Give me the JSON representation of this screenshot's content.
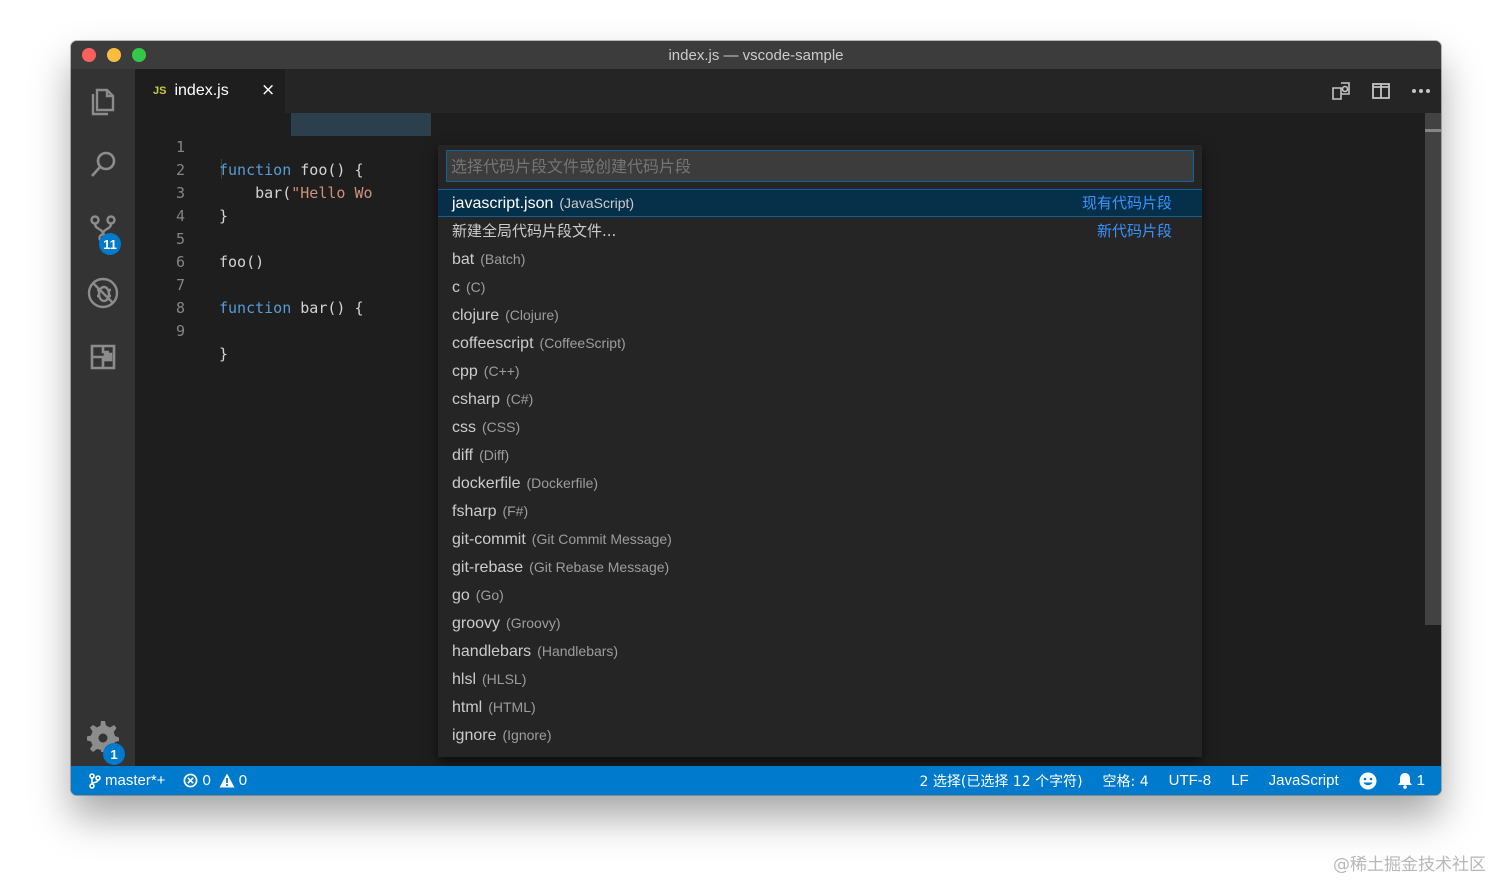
{
  "window": {
    "title": "index.js — vscode-sample"
  },
  "activity_bar": {
    "items": [
      {
        "icon": "explorer-icon"
      },
      {
        "icon": "search-icon"
      },
      {
        "icon": "source-control-icon",
        "badge": "11"
      },
      {
        "icon": "debug-icon"
      },
      {
        "icon": "extensions-icon"
      }
    ],
    "settings": {
      "icon": "gear-icon",
      "badge": "1"
    }
  },
  "tabs": [
    {
      "language_icon": "JS",
      "label": "index.js",
      "close": "×"
    }
  ],
  "editor": {
    "line_numbers": [
      "1",
      "2",
      "3",
      "4",
      "5",
      "6",
      "7",
      "8",
      "9"
    ],
    "lines": [
      {
        "kw": "function",
        "rest": " foo() {"
      },
      {
        "kw": "",
        "rest": "    bar(",
        "str": "\"Hello Wo"
      },
      {
        "kw": "",
        "rest": "}"
      },
      {
        "kw": "",
        "rest": ""
      },
      {
        "kw": "",
        "rest": "foo()"
      },
      {
        "kw": "",
        "rest": ""
      },
      {
        "kw": "function",
        "rest": " bar() {"
      },
      {
        "kw": "",
        "rest": ""
      },
      {
        "kw": "",
        "rest": "}"
      }
    ]
  },
  "quick_pick": {
    "placeholder": "选择代码片段文件或创建代码片段",
    "items": [
      {
        "label": "javascript.json",
        "desc": "(JavaScript)",
        "right": "现有代码片段"
      },
      {
        "label": "新建全局代码片段文件...",
        "desc": "",
        "right": "新代码片段"
      },
      {
        "label": "bat",
        "desc": "(Batch)"
      },
      {
        "label": "c",
        "desc": "(C)"
      },
      {
        "label": "clojure",
        "desc": "(Clojure)"
      },
      {
        "label": "coffeescript",
        "desc": "(CoffeeScript)"
      },
      {
        "label": "cpp",
        "desc": "(C++)"
      },
      {
        "label": "csharp",
        "desc": "(C#)"
      },
      {
        "label": "css",
        "desc": "(CSS)"
      },
      {
        "label": "diff",
        "desc": "(Diff)"
      },
      {
        "label": "dockerfile",
        "desc": "(Dockerfile)"
      },
      {
        "label": "fsharp",
        "desc": "(F#)"
      },
      {
        "label": "git-commit",
        "desc": "(Git Commit Message)"
      },
      {
        "label": "git-rebase",
        "desc": "(Git Rebase Message)"
      },
      {
        "label": "go",
        "desc": "(Go)"
      },
      {
        "label": "groovy",
        "desc": "(Groovy)"
      },
      {
        "label": "handlebars",
        "desc": "(Handlebars)"
      },
      {
        "label": "hlsl",
        "desc": "(HLSL)"
      },
      {
        "label": "html",
        "desc": "(HTML)"
      },
      {
        "label": "ignore",
        "desc": "(Ignore)"
      }
    ]
  },
  "status_bar": {
    "branch": "master*+",
    "errors": "0",
    "warnings": "0",
    "selection": "2 选择(已选择 12 个字符)",
    "spaces": "空格: 4",
    "encoding": "UTF-8",
    "eol": "LF",
    "language": "JavaScript",
    "notifications": "1"
  },
  "watermark": "@稀土掘金技术社区",
  "colors": {
    "accent": "#007acc",
    "keyword": "#569cd6",
    "string": "#ce9178",
    "link": "#3794ff"
  }
}
